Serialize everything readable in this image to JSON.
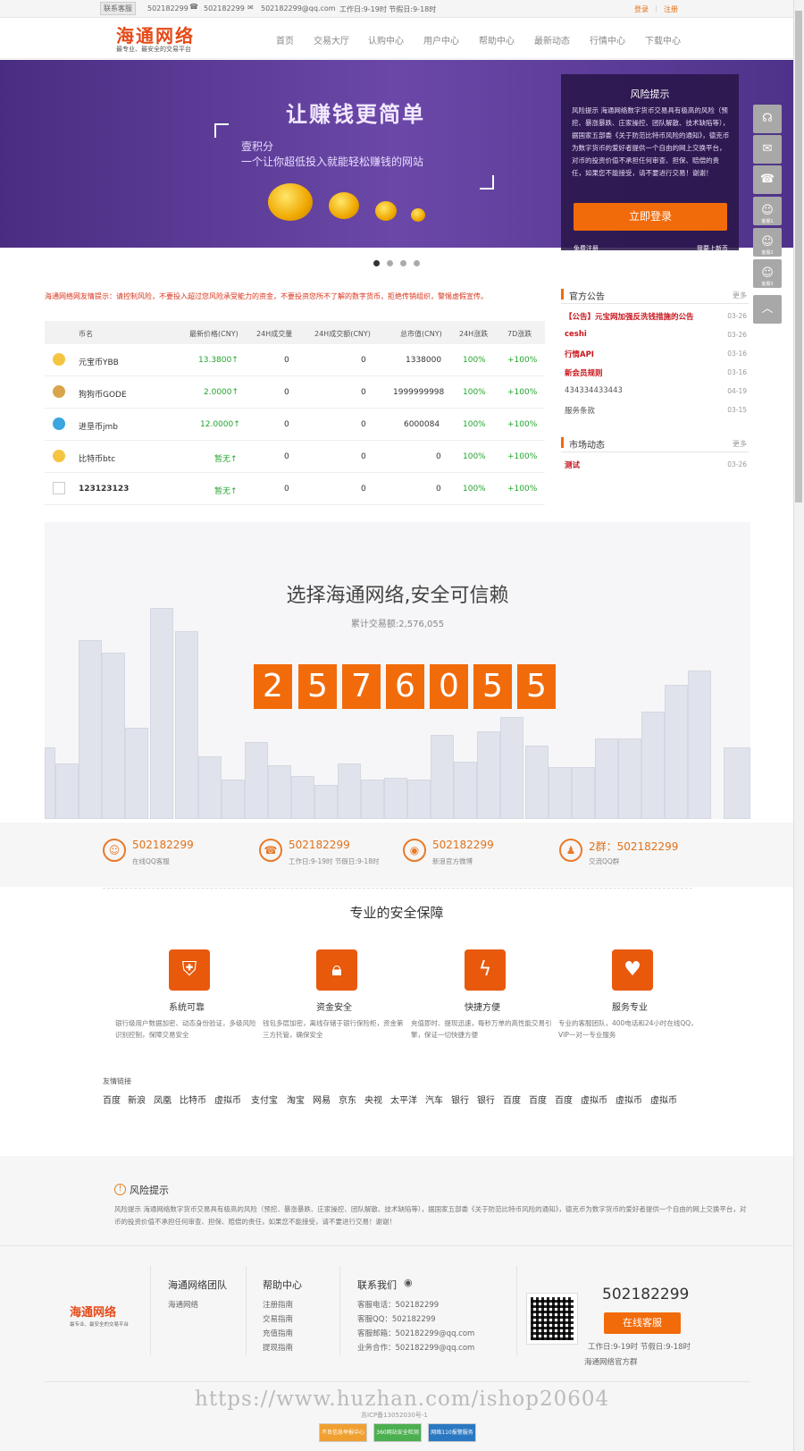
{
  "topbar": {
    "service_btn": "联系客服",
    "qq": "502182299",
    "phone": "502182299",
    "email": "502182299@qq.com",
    "hours": "工作日:9-19时 节假日:9-18时",
    "login": "登录",
    "register": "注册"
  },
  "header": {
    "logo": "海通网络",
    "slogan": "最专业、最安全的交易平台",
    "nav": [
      "首页",
      "交易大厅",
      "认购中心",
      "用户中心",
      "帮助中心",
      "最新动态",
      "行情中心",
      "下载中心"
    ]
  },
  "banner": {
    "title": "让赚钱更简单",
    "sub1": "壹积分",
    "sub2": "一个让你超低投入就能轻松赚钱的网站"
  },
  "risk_box": {
    "title": "风险提示",
    "text": "风险提示 海通网络数字货币交易具有极高的风险（预挖、暴涨暴跌、庄家操控、团队解散、技术缺陷等），据国家五部委《关于防范比特币风险的通知》，德克币为数字货币的爱好者提供一个自由的网上交换平台，对币的投资价值不承担任何审查、担保、赔偿的责任，如果您不能接受，请不要进行交易！谢谢！",
    "login_btn": "立即登录",
    "free_reg": "免费注册",
    "coin_up": "我要上新币"
  },
  "warning": "海通网络网友情提示：请控制风险，不要投入超过您风险承受能力的资金，不要投资您所不了解的数字货币，拒绝传销组织，警惕虚假宣传。",
  "market": {
    "headers": [
      "币名",
      "最新价格(CNY)",
      "24H成交量",
      "24H成交额(CNY)",
      "总市值(CNY)",
      "24H涨跌",
      "7D涨跌"
    ],
    "rows": [
      {
        "name": "元宝币YBB",
        "price": "13.3800↑",
        "vol": "0",
        "amount": "0",
        "cap": "1338000",
        "d1": "100%",
        "d7": "+100%"
      },
      {
        "name": "狗狗币GODE",
        "price": "2.0000↑",
        "vol": "0",
        "amount": "0",
        "cap": "1999999998",
        "d1": "100%",
        "d7": "+100%"
      },
      {
        "name": "进垦币jmb",
        "price": "12.0000↑",
        "vol": "0",
        "amount": "0",
        "cap": "6000084",
        "d1": "100%",
        "d7": "+100%"
      },
      {
        "name": "比特币btc",
        "price": "暂无↑",
        "vol": "0",
        "amount": "0",
        "cap": "0",
        "d1": "100%",
        "d7": "+100%"
      },
      {
        "name": "123123123",
        "price": "暂无↑",
        "vol": "0",
        "amount": "0",
        "cap": "0",
        "d1": "100%",
        "d7": "+100%"
      }
    ]
  },
  "announce": {
    "title": "官方公告",
    "more": "更多",
    "items": [
      {
        "text": "【公告】元宝网加强反洗钱措施的公告",
        "date": "03-26",
        "bold": true
      },
      {
        "text": "ceshi",
        "date": "03-26",
        "bold": true
      },
      {
        "text": "行情API",
        "date": "03-16",
        "bold": true
      },
      {
        "text": "新会员规则",
        "date": "03-16",
        "bold": true
      },
      {
        "text": "434334433443",
        "date": "04-19",
        "bold": false
      },
      {
        "text": "服务条款",
        "date": "03-15",
        "bold": false
      }
    ]
  },
  "dynamics": {
    "title": "市场动态",
    "more": "更多",
    "items": [
      {
        "text": "测试",
        "date": "03-26"
      }
    ]
  },
  "stats": {
    "title": "选择海通网络,安全可信赖",
    "sub": "累计交易额:2,576,055",
    "digits": [
      "2",
      "5",
      "7",
      "6",
      "0",
      "5",
      "5"
    ]
  },
  "contacts": [
    {
      "num": "502182299",
      "desc": "在线QQ客服",
      "icon": "qq-icon"
    },
    {
      "num": "502182299",
      "desc": "工作日:9-19时 节假日:9-18时",
      "icon": "phone-icon"
    },
    {
      "num": "502182299",
      "desc": "新浪官方微博",
      "icon": "weibo-icon"
    },
    {
      "num": "2群：502182299",
      "desc": "交流QQ群",
      "icon": "group-icon"
    }
  ],
  "security": {
    "title": "专业的安全保障",
    "features": [
      {
        "name": "系统可靠",
        "desc": "银行级用户数据加密、动态身份验证，多级风险识别控制，保障交易安全"
      },
      {
        "name": "资金安全",
        "desc": "钱包多层加密，离线存储于银行保险柜，资金第三方托管，确保安全"
      },
      {
        "name": "快捷方便",
        "desc": "充值即时、提现迅速，每秒万单的高性能交易引擎，保证一切快捷方便"
      },
      {
        "name": "服务专业",
        "desc": "专业的客服团队，400电话和24小时在线QQ，VIP一对一专业服务"
      }
    ]
  },
  "friend_links": {
    "title": "友情链接",
    "items": [
      "百度",
      "新浪",
      "凤凰",
      "比特币",
      "虚拟币",
      "支付宝",
      "淘宝",
      "网易",
      "京东",
      "央视",
      "太平洋",
      "汽车",
      "银行",
      "银行",
      "百度",
      "百度",
      "百度",
      "虚拟币",
      "虚拟币",
      "虚拟币"
    ]
  },
  "risk2": {
    "title": "风险提示",
    "text": "风险提示 海通网络数字货币交易具有极高的风险（预挖、暴涨暴跌、庄家操控、团队解散、技术缺陷等），据国家五部委《关于防范比特币风险的通知》，德克币为数字货币的爱好者提供一个自由的网上交换平台，对币的投资价值不承担任何审查、担保、赔偿的责任，如果您不能接受，请不要进行交易！谢谢！"
  },
  "footer": {
    "logo": "海通网络",
    "slogan": "最专业、最安全的交易平台",
    "team": {
      "title": "海通网络团队",
      "items": [
        "海通网络"
      ]
    },
    "help": {
      "title": "帮助中心",
      "items": [
        "注册指南",
        "交易指南",
        "充值指南",
        "提现指南"
      ]
    },
    "contact": {
      "title": "联系我们",
      "items": [
        "客服电话：502182299",
        "客服QQ：502182299",
        "客服邮箱：502182299@qq.com",
        "业务合作：502182299@qq.com"
      ]
    },
    "phone": "502182299",
    "kf_btn": "在线客服",
    "hours": "工作日:9-19时 节假日:9-18时",
    "wechat": "海通网络官方群",
    "watermark": "https://www.huzhan.com/ishop20604",
    "icp": "苏ICP备13052030号-1",
    "badges": [
      "不良信息举报中心",
      "360网站安全检测",
      "网络110报警服务"
    ]
  },
  "float": {
    "kf1": "客服1",
    "kf2": "客服2",
    "kf3": "客服3"
  }
}
